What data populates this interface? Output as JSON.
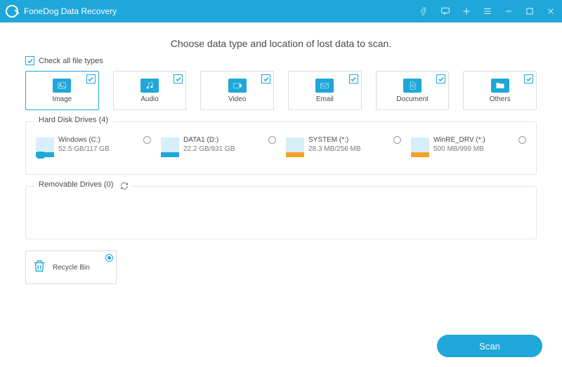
{
  "titlebar": {
    "app_name": "FoneDog Data Recovery"
  },
  "instruction": "Choose data type and location of lost data to scan.",
  "check_all_label": "Check all file types",
  "file_types": [
    {
      "label": "Image",
      "icon": "image"
    },
    {
      "label": "Audio",
      "icon": "audio"
    },
    {
      "label": "Video",
      "icon": "video"
    },
    {
      "label": "Email",
      "icon": "email"
    },
    {
      "label": "Document",
      "icon": "document"
    },
    {
      "label": "Others",
      "icon": "folder"
    }
  ],
  "hdd_section_title": "Hard Disk Drives (4)",
  "drives": [
    {
      "name": "Windows (C:)",
      "size": "52.5 GB/117 GB",
      "bar_color": "#1ea7d8",
      "fill_pct": 45,
      "badge": true
    },
    {
      "name": "DATA1 (D:)",
      "size": "22.2 GB/931 GB",
      "bar_color": "#1ea7d8",
      "fill_pct": 3
    },
    {
      "name": "SYSTEM (*:)",
      "size": "28.3 MB/256 MB",
      "bar_color": "#f4a228",
      "fill_pct": 12
    },
    {
      "name": "WinRE_DRV (*:)",
      "size": "500 MB/999 MB",
      "bar_color": "#f4a228",
      "fill_pct": 50
    }
  ],
  "removable_section_title": "Removable Drives (0)",
  "recycle_bin_label": "Recycle Bin",
  "scan_button_label": "Scan"
}
